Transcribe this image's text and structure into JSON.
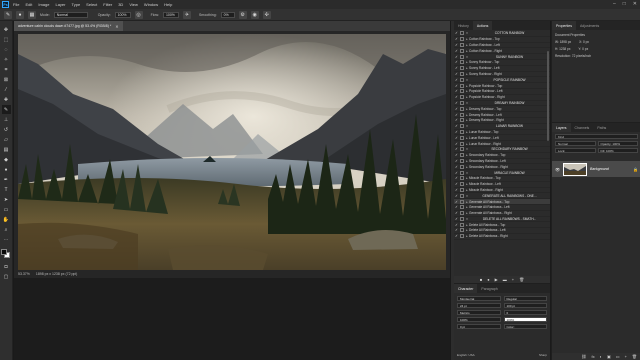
{
  "menu": {
    "logo": "Ps",
    "items": [
      "File",
      "Edit",
      "Image",
      "Layer",
      "Type",
      "Select",
      "Filter",
      "3D",
      "View",
      "Window",
      "Help"
    ]
  },
  "window_controls": {
    "minimize": "–",
    "maximize": "□",
    "close": "✕"
  },
  "options_bar": {
    "mode_label": "Mode:",
    "mode_value": "Normal",
    "opacity_label": "Opacity:",
    "opacity_value": "100%",
    "flow_label": "Flow:",
    "flow_value": "100%",
    "smoothing_label": "Smoothing:",
    "smoothing_value": "0%"
  },
  "document": {
    "tab_title": "adventure cabin clouds dawn #7477.jpg @ 53.4% (RGB/8) *",
    "close_glyph": "✕",
    "zoom": "53.37%",
    "size": "1898 px x 1238 px (72 ppi)"
  },
  "history_panel": {
    "tabs": [
      "History",
      "Actions"
    ],
    "actions": [
      {
        "label": "COTTON RAINBOW",
        "kind": "set"
      },
      {
        "label": "Cotton Rainbow - Top",
        "kind": "item"
      },
      {
        "label": "Cotton Rainbow - Left",
        "kind": "item"
      },
      {
        "label": "Cotton Rainbow - Right",
        "kind": "item"
      },
      {
        "label": "SUNNY RAINBOW",
        "kind": "set"
      },
      {
        "label": "Sunny Rainbow - Top",
        "kind": "item"
      },
      {
        "label": "Sunny Rainbow - Left",
        "kind": "item"
      },
      {
        "label": "Sunny Rainbow - Right",
        "kind": "item"
      },
      {
        "label": "POPSICLE RAINBOW",
        "kind": "set"
      },
      {
        "label": "Popsicle Rainbow - Top",
        "kind": "item"
      },
      {
        "label": "Popsicle Rainbow - Left",
        "kind": "item"
      },
      {
        "label": "Popsicle Rainbow - Right",
        "kind": "item"
      },
      {
        "label": "DREAMY RAINBOW",
        "kind": "set"
      },
      {
        "label": "Dreamy Rainbow - Top",
        "kind": "item"
      },
      {
        "label": "Dreamy Rainbow - Left",
        "kind": "item"
      },
      {
        "label": "Dreamy Rainbow - Right",
        "kind": "item"
      },
      {
        "label": "LUNAR RAINBOW",
        "kind": "set"
      },
      {
        "label": "Lunar Rainbow - Top",
        "kind": "item"
      },
      {
        "label": "Lunar Rainbow - Left",
        "kind": "item"
      },
      {
        "label": "Lunar Rainbow - Right",
        "kind": "item"
      },
      {
        "label": "SECONDARY RAINBOW",
        "kind": "set"
      },
      {
        "label": "Secondary Rainbow - Top",
        "kind": "item"
      },
      {
        "label": "Secondary Rainbow - Left",
        "kind": "item"
      },
      {
        "label": "Secondary Rainbow - Right",
        "kind": "item"
      },
      {
        "label": "MIRACLE RAINBOW",
        "kind": "set"
      },
      {
        "label": "Miracle Rainbow - Top",
        "kind": "item"
      },
      {
        "label": "Miracle Rainbow - Left",
        "kind": "item"
      },
      {
        "label": "Miracle Rainbow - Right",
        "kind": "item"
      },
      {
        "label": "GENERATE ALL RAINBOWS - ONE...",
        "kind": "set"
      },
      {
        "label": "Generate All Rainbows - Top",
        "kind": "item",
        "selected": true
      },
      {
        "label": "Generate All Rainbows - Left",
        "kind": "item"
      },
      {
        "label": "Generate All Rainbows - Right",
        "kind": "item"
      },
      {
        "label": "DELETE ALL RAINBOWS - SMATH...",
        "kind": "set"
      },
      {
        "label": "Delete All Rainbows - Top",
        "kind": "item"
      },
      {
        "label": "Delete All Rainbows - Left",
        "kind": "item"
      },
      {
        "label": "Delete All Rainbows - Right",
        "kind": "item"
      }
    ],
    "footer_icons": [
      "■",
      "●",
      "▶",
      "▬",
      "+",
      "🗑"
    ]
  },
  "character_panel": {
    "tabs": [
      "Character",
      "Paragraph"
    ],
    "font_family": "Montserrat",
    "font_style": "Regular",
    "size": "24 pt",
    "leading": "100 pt",
    "tracking_label": "Metrics",
    "tracking": "0",
    "vscale": "100%",
    "hscale": "100%",
    "baseline": "0 pt",
    "color_label": "Color:",
    "language": "English: USA",
    "aa": "Sharp"
  },
  "properties_panel": {
    "tabs": [
      "Properties",
      "Adjustments"
    ],
    "doc_label": "Document Properties",
    "w": "W: 1898 px",
    "h": "H: 1238 px",
    "x": "X: 0 px",
    "y": "Y: 0 px",
    "resolution": "Resolution: 72 pixels/inch"
  },
  "layers_panel": {
    "tabs": [
      "Layers",
      "Channels",
      "Paths"
    ],
    "filter_kind": "Kind",
    "blend_mode": "Normal",
    "opacity": "Opacity: 100%",
    "lock_label": "Lock:",
    "fill": "Fill: 100%",
    "layer_name": "Background",
    "footer_icons": [
      "⛓",
      "fx",
      "◐",
      "▣",
      "▭",
      "+",
      "🗑"
    ]
  },
  "colors": {
    "accent": "#31a8ff",
    "selected_row": "#3c3c3c",
    "panel_bg": "#2b2b2b"
  }
}
